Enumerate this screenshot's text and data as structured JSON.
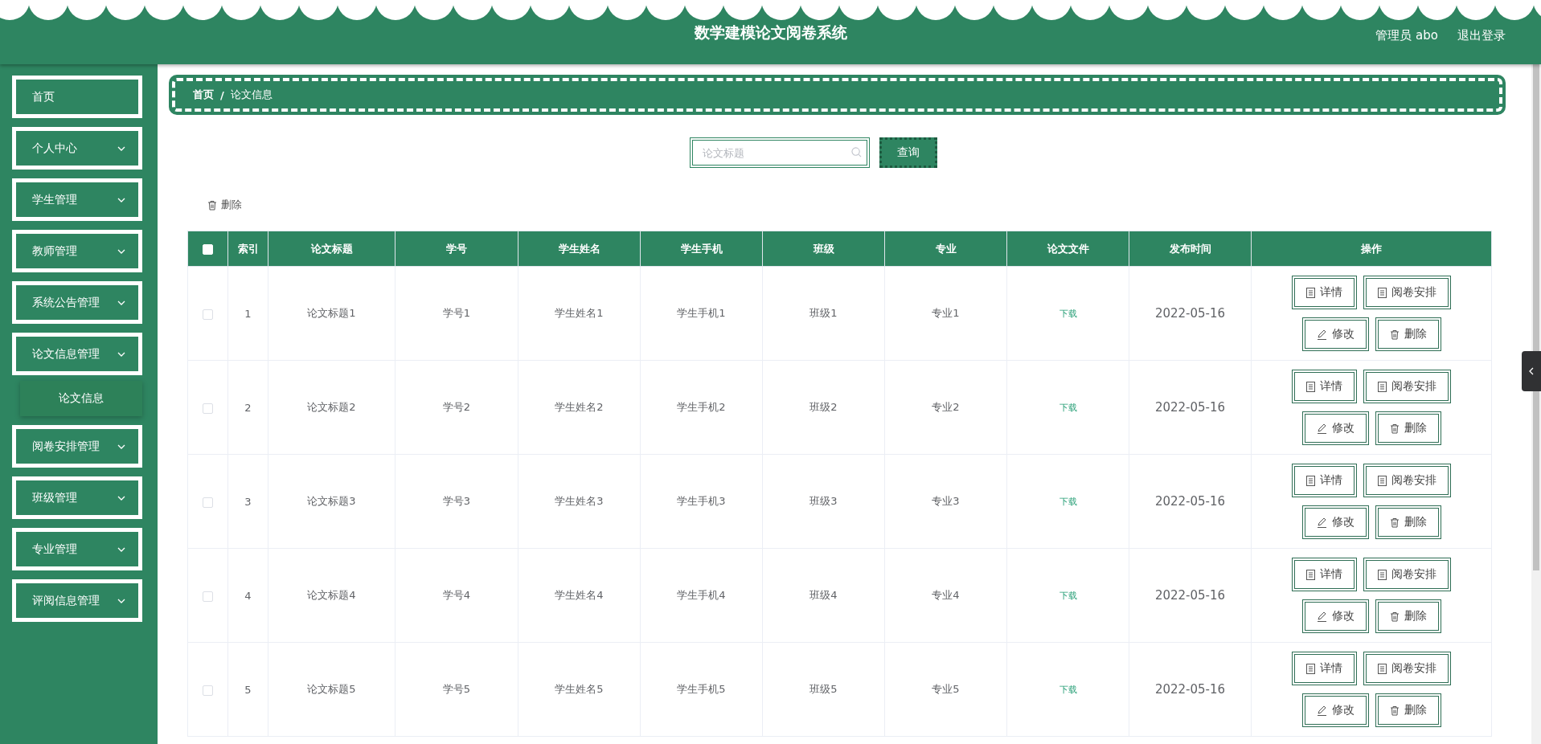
{
  "header": {
    "title": "数学建模论文阅卷系统",
    "user": "管理员 abo",
    "logout": "退出登录"
  },
  "sidebar": {
    "items": [
      {
        "label": "首页",
        "kind": "link"
      },
      {
        "label": "个人中心",
        "kind": "menu"
      },
      {
        "label": "学生管理",
        "kind": "menu"
      },
      {
        "label": "教师管理",
        "kind": "menu"
      },
      {
        "label": "系统公告管理",
        "kind": "menu"
      },
      {
        "label": "论文信息管理",
        "kind": "menu",
        "children": [
          {
            "label": "论文信息"
          }
        ]
      },
      {
        "label": "阅卷安排管理",
        "kind": "menu"
      },
      {
        "label": "班级管理",
        "kind": "menu"
      },
      {
        "label": "专业管理",
        "kind": "menu"
      },
      {
        "label": "评阅信息管理",
        "kind": "menu"
      }
    ]
  },
  "breadcrumb": {
    "items": [
      "首页",
      "论文信息"
    ],
    "separator": "/"
  },
  "search": {
    "placeholder": "论文标题",
    "button": "查询"
  },
  "toolbar": {
    "delete": "删除"
  },
  "table": {
    "header_checked": false,
    "columns": [
      "索引",
      "论文标题",
      "学号",
      "学生姓名",
      "学生手机",
      "班级",
      "专业",
      "论文文件",
      "发布时间",
      "操作"
    ],
    "rows": [
      {
        "checked": false,
        "cells": [
          "1",
          "论文标题1",
          "学号1",
          "学生姓名1",
          "学生手机1",
          "班级1",
          "专业1"
        ],
        "file": "下载",
        "date": "2022-05-16",
        "actions": [
          {
            "label": "详情",
            "kind": "detail"
          },
          {
            "label": "阅卷安排",
            "kind": "detail"
          },
          {
            "label": "修改",
            "kind": "edit"
          },
          {
            "label": "删除",
            "kind": "delete"
          }
        ]
      },
      {
        "checked": false,
        "cells": [
          "2",
          "论文标题2",
          "学号2",
          "学生姓名2",
          "学生手机2",
          "班级2",
          "专业2"
        ],
        "file": "下载",
        "date": "2022-05-16",
        "actions": [
          {
            "label": "详情",
            "kind": "detail"
          },
          {
            "label": "阅卷安排",
            "kind": "detail"
          },
          {
            "label": "修改",
            "kind": "edit"
          },
          {
            "label": "删除",
            "kind": "delete"
          }
        ]
      },
      {
        "checked": false,
        "cells": [
          "3",
          "论文标题3",
          "学号3",
          "学生姓名3",
          "学生手机3",
          "班级3",
          "专业3"
        ],
        "file": "下载",
        "date": "2022-05-16",
        "actions": [
          {
            "label": "详情",
            "kind": "detail"
          },
          {
            "label": "阅卷安排",
            "kind": "detail"
          },
          {
            "label": "修改",
            "kind": "edit"
          },
          {
            "label": "删除",
            "kind": "delete"
          }
        ]
      },
      {
        "checked": false,
        "cells": [
          "4",
          "论文标题4",
          "学号4",
          "学生姓名4",
          "学生手机4",
          "班级4",
          "专业4"
        ],
        "file": "下载",
        "date": "2022-05-16",
        "actions": [
          {
            "label": "详情",
            "kind": "detail"
          },
          {
            "label": "阅卷安排",
            "kind": "detail"
          },
          {
            "label": "修改",
            "kind": "edit"
          },
          {
            "label": "删除",
            "kind": "delete"
          }
        ]
      },
      {
        "checked": false,
        "cells": [
          "5",
          "论文标题5",
          "学号5",
          "学生姓名5",
          "学生手机5",
          "班级5",
          "专业5"
        ],
        "file": "下载",
        "date": "2022-05-16",
        "actions": [
          {
            "label": "详情",
            "kind": "detail"
          },
          {
            "label": "阅卷安排",
            "kind": "detail"
          },
          {
            "label": "修改",
            "kind": "edit"
          },
          {
            "label": "删除",
            "kind": "delete"
          }
        ]
      }
    ]
  }
}
